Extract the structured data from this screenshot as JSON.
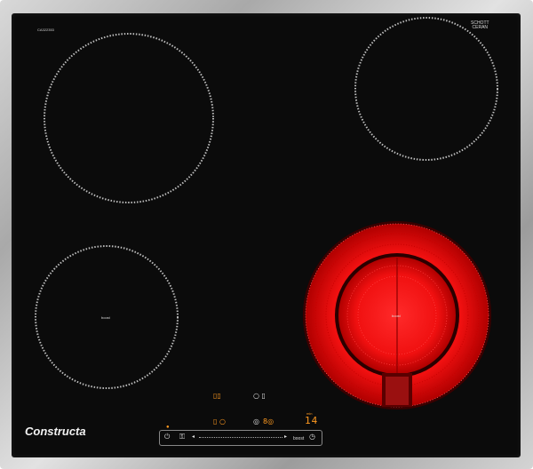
{
  "model_code": "CA322353",
  "brand": "Constructa",
  "glass_maker": {
    "line1": "SCHOTT",
    "line2": "CERAN"
  },
  "zones": [
    {
      "id": "front-left",
      "label": "boost"
    },
    {
      "id": "front-right",
      "label": "boost"
    }
  ],
  "controls": {
    "boost_label": "boost",
    "display_value": "14",
    "display_caption": "min"
  },
  "colors": {
    "glass": "#0b0b0b",
    "heating": "#ff1f1f",
    "indicator": "#ff9a20"
  },
  "icons": [
    "power-icon",
    "child-lock-icon",
    "slider-arrow-left-icon",
    "slider-arrow-right-icon",
    "timer-icon",
    "zone-selector-icon"
  ]
}
